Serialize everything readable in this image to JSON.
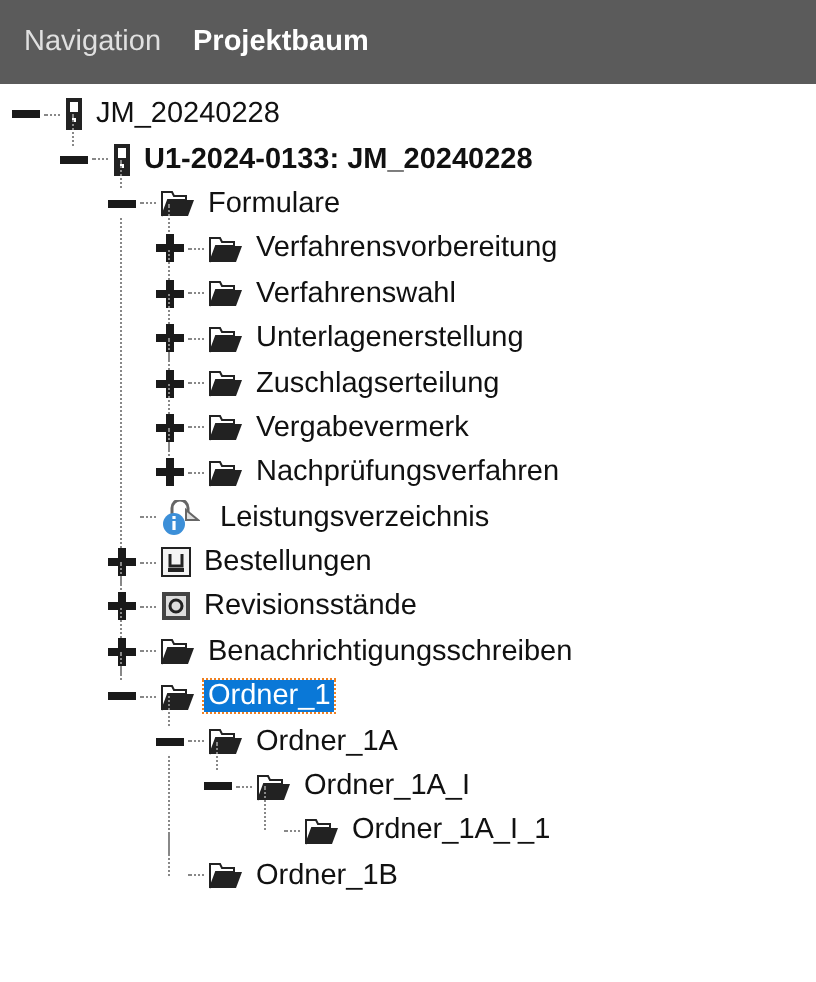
{
  "tabs": [
    {
      "label": "Navigation",
      "selected": false
    },
    {
      "label": "Projektbaum",
      "selected": true
    }
  ],
  "tree": [
    {
      "label": "JM_20240228",
      "kind": "device",
      "bold": false,
      "selected": false,
      "expanded": true,
      "children": [
        {
          "label": "U1-2024-0133:  JM_20240228",
          "kind": "device",
          "bold": true,
          "selected": false,
          "expanded": true,
          "children": [
            {
              "label": "Formulare",
              "kind": "folder",
              "bold": false,
              "selected": false,
              "expanded": true,
              "children": [
                {
                  "label": "Verfahrensvorbereitung",
                  "kind": "folder",
                  "bold": false,
                  "selected": false,
                  "expanded": false
                },
                {
                  "label": "Verfahrenswahl",
                  "kind": "folder",
                  "bold": false,
                  "selected": false,
                  "expanded": false
                },
                {
                  "label": "Unterlagenerstellung",
                  "kind": "folder",
                  "bold": false,
                  "selected": false,
                  "expanded": false
                },
                {
                  "label": "Zuschlagserteilung",
                  "kind": "folder",
                  "bold": false,
                  "selected": false,
                  "expanded": false
                },
                {
                  "label": "Vergabevermerk",
                  "kind": "folder",
                  "bold": false,
                  "selected": false,
                  "expanded": false
                },
                {
                  "label": "Nachprüfungsverfahren",
                  "kind": "folder",
                  "bold": false,
                  "selected": false,
                  "expanded": false
                }
              ]
            },
            {
              "label": "Leistungsverzeichnis",
              "kind": "info",
              "bold": false,
              "selected": false
            },
            {
              "label": "Bestellungen",
              "kind": "order",
              "bold": false,
              "selected": false,
              "expanded": false
            },
            {
              "label": "Revisionsstände",
              "kind": "revision",
              "bold": false,
              "selected": false,
              "expanded": false
            },
            {
              "label": "Benachrichtigungsschreiben",
              "kind": "folder",
              "bold": false,
              "selected": false,
              "expanded": false
            },
            {
              "label": "Ordner_1",
              "kind": "folder",
              "bold": false,
              "selected": true,
              "expanded": true,
              "children": [
                {
                  "label": "Ordner_1A",
                  "kind": "folder",
                  "bold": false,
                  "selected": false,
                  "expanded": true,
                  "children": [
                    {
                      "label": "Ordner_1A_I",
                      "kind": "folder",
                      "bold": false,
                      "selected": false,
                      "expanded": true,
                      "children": [
                        {
                          "label": "Ordner_1A_I_1",
                          "kind": "folder",
                          "bold": false,
                          "selected": false
                        }
                      ]
                    }
                  ]
                },
                {
                  "label": "Ordner_1B",
                  "kind": "folder",
                  "bold": false,
                  "selected": false
                }
              ]
            }
          ]
        }
      ]
    }
  ]
}
